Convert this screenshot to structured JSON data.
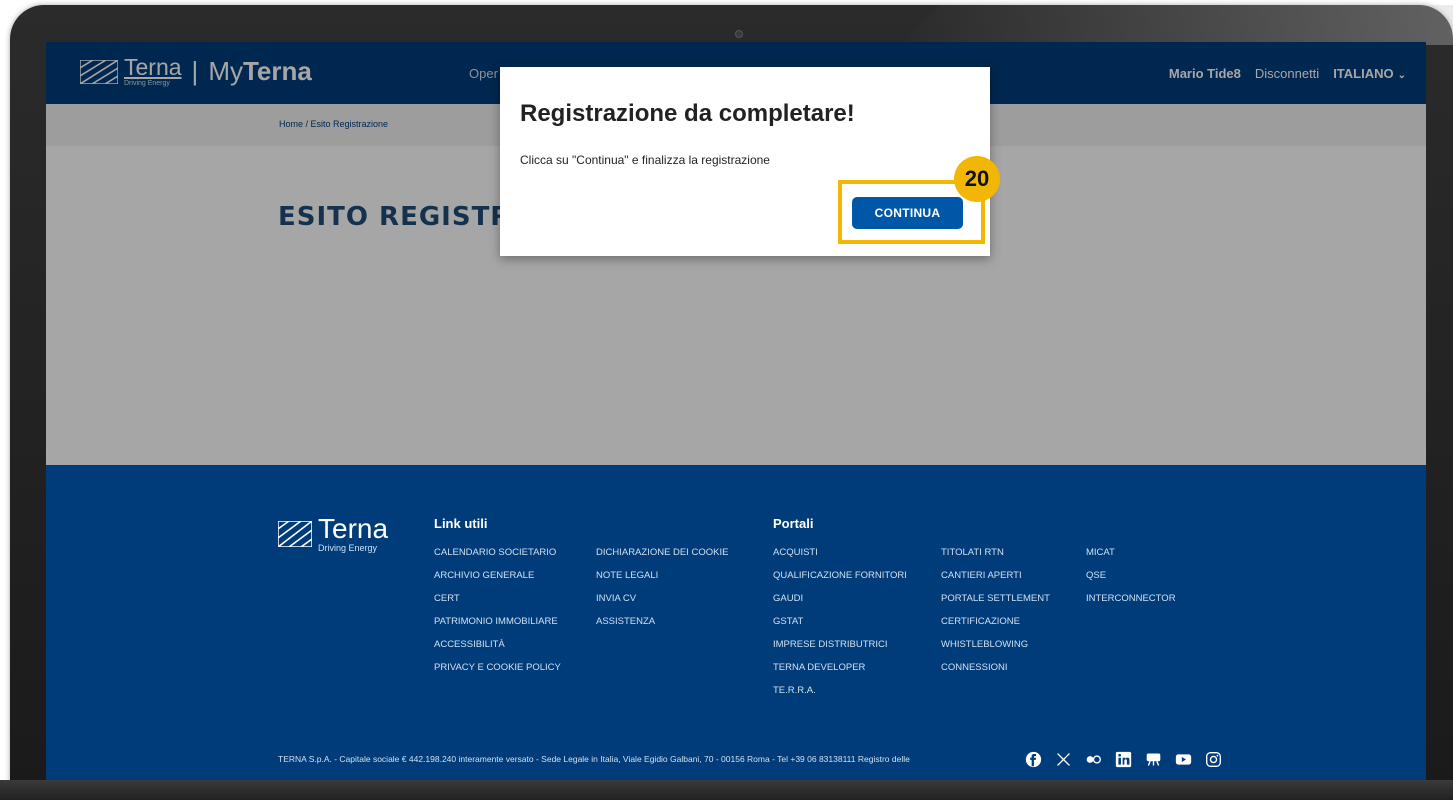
{
  "header": {
    "brand_name": "Terna",
    "brand_tagline": "Driving Energy",
    "separator": "|",
    "product_prefix": "My",
    "product_name": "Terna",
    "nav_partial": "Oper",
    "user_name": "Mario Tide8",
    "logout_label": "Disconnetti",
    "language_label": "ITALIANO",
    "language_chevron": "⌄"
  },
  "breadcrumb": {
    "text": "Home  /  Esito Registrazione"
  },
  "page": {
    "title": "ESITO REGISTRAZIO"
  },
  "modal": {
    "title": "Registrazione da completare!",
    "body": "Clicca su \"Continua\" e finalizza la registrazione",
    "continue_label": "CONTINUA"
  },
  "annotation": {
    "step_number": "20",
    "highlight_color": "#f2b705"
  },
  "footer": {
    "brand_name": "Terna",
    "brand_tagline": "Driving Energy",
    "link_utili_title": "Link utili",
    "link_utili_col1": [
      "CALENDARIO SOCIETARIO",
      "ARCHIVIO GENERALE",
      "CERT",
      "PATRIMONIO IMMOBILIARE",
      "ACCESSIBILITÀ",
      "PRIVACY E COOKIE POLICY"
    ],
    "link_utili_col2": [
      "DICHIARAZIONE DEI COOKIE",
      "NOTE LEGALI",
      "INVIA CV",
      "ASSISTENZA"
    ],
    "portali_title": "Portali",
    "portali_col1": [
      "ACQUISTI",
      "QUALIFICAZIONE FORNITORI",
      "GAUDI",
      "GSTAT",
      "IMPRESE DISTRIBUTRICI",
      "TERNA DEVELOPER",
      "TE.R.R.A."
    ],
    "portali_col2": [
      "TITOLATI RTN",
      "CANTIERI APERTI",
      "PORTALE SETTLEMENT",
      "CERTIFICAZIONE",
      "WHISTLEBLOWING",
      "CONNESSIONI"
    ],
    "portali_col3": [
      "MICAT",
      "QSE",
      "INTERCONNECTOR"
    ],
    "legal": "TERNA S.p.A. - Capitale sociale € 442.198.240 interamente versato - Sede Legale in Italia, Viale Egidio Galbani, 70 - 00156 Roma - Tel +39 06 83138111 Registro delle",
    "social_icons": [
      "facebook-icon",
      "x-icon",
      "flickr-icon",
      "linkedin-icon",
      "hub-icon",
      "youtube-icon",
      "instagram-icon"
    ]
  },
  "colors": {
    "primary_blue": "#003c7a",
    "button_blue": "#0057a8",
    "title_blue": "#1f4e79"
  }
}
